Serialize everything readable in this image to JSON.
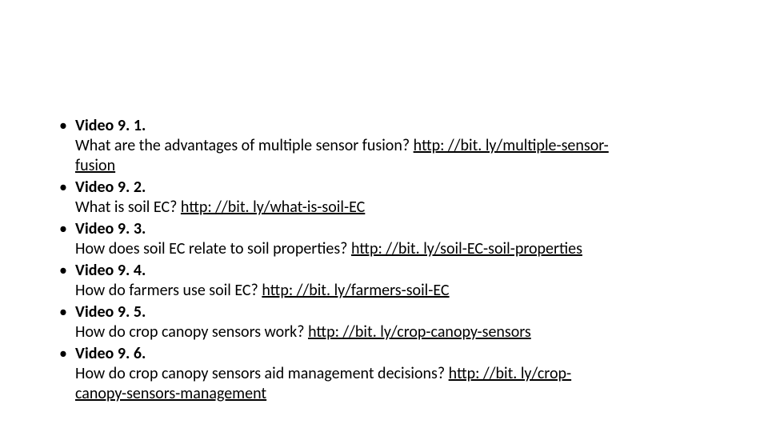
{
  "items": [
    {
      "title": "Video 9. 1.",
      "question": "What are the advantages of multiple sensor fusion? ",
      "link_a": "http: //bit. ly/multiple-sensor-",
      "link_b": "fusion"
    },
    {
      "title": "Video 9. 2.",
      "question": "What is soil EC? ",
      "link_a": "http: //bit. ly/what-is-soil-EC",
      "link_b": ""
    },
    {
      "title": "Video 9. 3.",
      "question": "How does soil EC relate to soil properties? ",
      "link_a": "http: //bit. ly/soil-EC-soil-properties",
      "link_b": ""
    },
    {
      "title": "Video 9. 4.",
      "question": "How do farmers use soil EC? ",
      "link_a": "http: //bit. ly/farmers-soil-EC",
      "link_b": ""
    },
    {
      "title": "Video 9. 5.",
      "question": "How do crop canopy sensors work? ",
      "link_a": "http: //bit. ly/crop-canopy-sensors",
      "link_b": ""
    },
    {
      "title": "Video 9. 6.",
      "question": "How do crop canopy sensors aid management decisions? ",
      "link_a": "http: //bit. ly/crop-",
      "link_b": "canopy-sensors-management"
    }
  ]
}
